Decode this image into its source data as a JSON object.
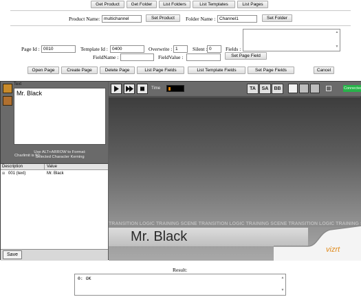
{
  "top_buttons": [
    "Get Product",
    "Get Folder",
    "List Folders",
    "List Templates",
    "List Pages"
  ],
  "product": {
    "label": "Product Name:",
    "value": "multichannel",
    "set_button": "Set Product"
  },
  "folder": {
    "label": "Folder Name :",
    "value": "Channel1",
    "set_button": "Set Folder"
  },
  "page": {
    "label": "Page Id :",
    "value": "0010"
  },
  "template": {
    "label": "Template Id :",
    "value": "0400"
  },
  "overwrite": {
    "label": "Overwrite :",
    "value": "1"
  },
  "silent": {
    "label": "Silent :",
    "value": "0"
  },
  "fields": {
    "label": "Fields :",
    "value": ""
  },
  "fieldname": {
    "label": "FieldName :",
    "value": ""
  },
  "fieldvalue": {
    "label": "FieldValue :",
    "value": "",
    "set_button": "Set Page Field"
  },
  "action_buttons": [
    "Open Page",
    "Create Page",
    "Delete Page",
    "List Page Fields",
    "List Template Fields",
    "Set Page Fields",
    "Cancel"
  ],
  "viz": {
    "text_tab": "Text",
    "text_value": "Mr. Black",
    "hint_line1": "Use ALT+ARROW to Format:",
    "hint_line2": "Selected Character Kerning",
    "charlimit": "Charlimit is 50",
    "table_headers": [
      "Description",
      "Value"
    ],
    "table_rows": [
      {
        "description": "001 (text)",
        "value": "Mr. Black"
      }
    ],
    "save_button": "Save",
    "time_label": "Time",
    "view_buttons": [
      "TA",
      "SA",
      "BB"
    ],
    "connected": "Connected",
    "scene_banner": "TRANSITION LOGIC TRAINING SCENE   TRANSITION LOGIC TRAINING SCENE   TRANSITION LOGIC TRAINING SCENE",
    "lower_third_name": "Mr. Black",
    "logo": "vizrt"
  },
  "result": {
    "label": "Result:",
    "value": "0: OK"
  }
}
